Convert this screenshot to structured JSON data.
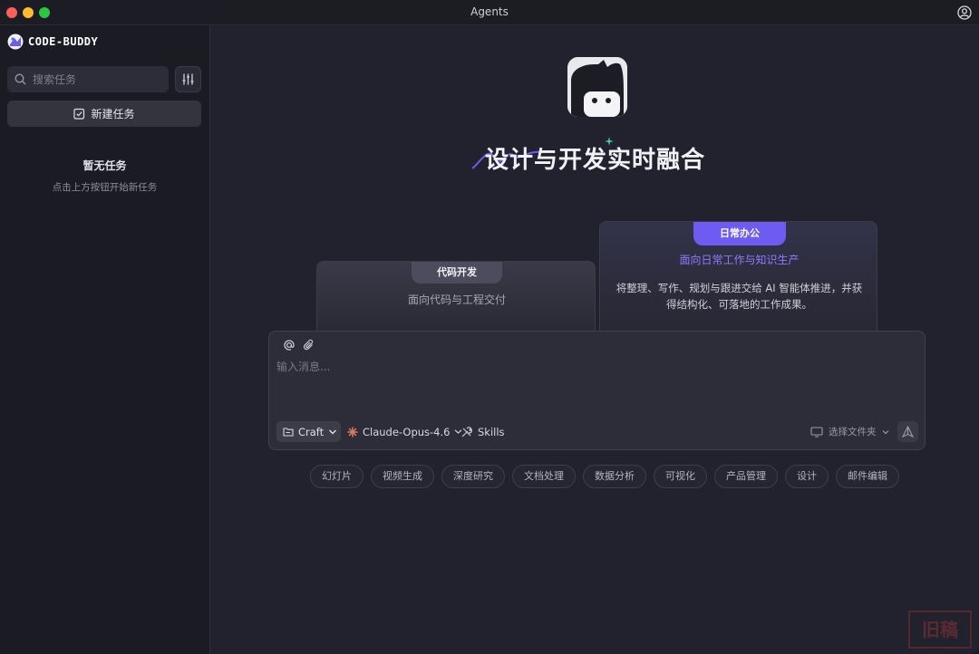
{
  "window": {
    "title": "Agents"
  },
  "sidebar": {
    "logo_text": "CODE-BUDDY",
    "search_placeholder": "搜索任务",
    "new_task_label": "新建任务",
    "empty_title": "暂无任务",
    "empty_subtitle": "点击上方按钮开始新任务"
  },
  "main": {
    "hero_title": "设计与开发实时融合",
    "modes": [
      {
        "tab": "代码开发",
        "subtitle": "面向代码与工程交付"
      },
      {
        "tab": "日常办公",
        "subtitle": "面向日常工作与知识生产",
        "description": "将整理、写作、规划与跟进交给 AI 智能体推进，并获得结构化、可落地的工作成果。"
      }
    ]
  },
  "composer": {
    "placeholder": "输入消息...",
    "mode_label": "Craft",
    "model_label": "Claude-Opus-4.6",
    "skills_label": "Skills",
    "folder_label": "选择文件夹"
  },
  "chips": [
    "幻灯片",
    "视频生成",
    "深度研究",
    "文档处理",
    "数据分析",
    "可视化",
    "产品管理",
    "设计",
    "邮件编辑"
  ],
  "colors": {
    "accent": "#6e5cf2",
    "accent_text": "#8c7cff",
    "background": "#22222f",
    "sidebar": "#1b1b24"
  },
  "watermark": "旧稿"
}
